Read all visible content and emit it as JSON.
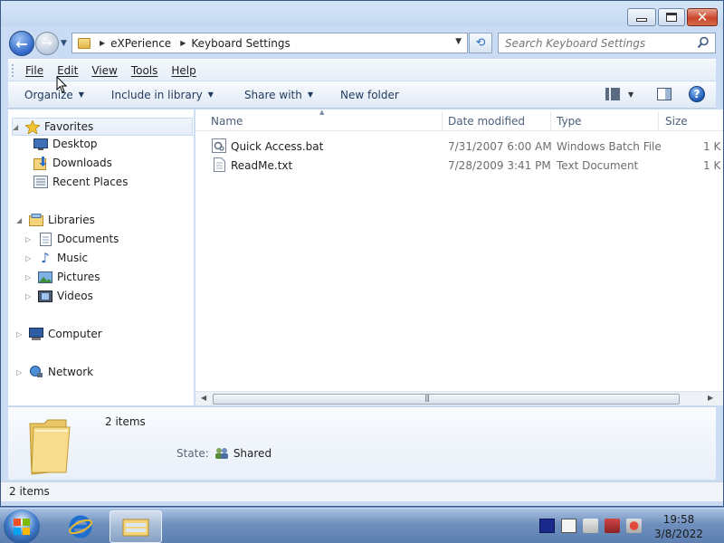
{
  "address": {
    "crumbs": [
      "eXPerience",
      "Keyboard Settings"
    ]
  },
  "search": {
    "placeholder": "Search Keyboard Settings"
  },
  "menu": {
    "file": "File",
    "edit": "Edit",
    "view": "View",
    "tools": "Tools",
    "help": "Help"
  },
  "toolbar": {
    "organize": "Organize",
    "include": "Include in library",
    "share": "Share with",
    "newfolder": "New folder"
  },
  "nav": {
    "favorites": "Favorites",
    "desktop": "Desktop",
    "downloads": "Downloads",
    "recent": "Recent Places",
    "libraries": "Libraries",
    "documents": "Documents",
    "music": "Music",
    "pictures": "Pictures",
    "videos": "Videos",
    "computer": "Computer",
    "network": "Network"
  },
  "columns": {
    "name": "Name",
    "date": "Date modified",
    "type": "Type",
    "size": "Size"
  },
  "files": [
    {
      "name": "Quick Access.bat",
      "date": "7/31/2007 6:00 AM",
      "type": "Windows Batch File",
      "size": "1 K"
    },
    {
      "name": "ReadMe.txt",
      "date": "7/28/2009 3:41 PM",
      "type": "Text Document",
      "size": "1 K"
    }
  ],
  "details": {
    "count": "2 items",
    "state_label": "State:",
    "state_value": "Shared"
  },
  "status": {
    "text": "2 items"
  },
  "clock": {
    "time": "19:58",
    "date": "3/8/2022"
  },
  "icons": {
    "back": "back-arrow-icon",
    "forward": "forward-arrow-icon",
    "folder": "folder-icon",
    "refresh": "refresh-icon",
    "search": "magnifier-icon",
    "help": "help-icon"
  }
}
